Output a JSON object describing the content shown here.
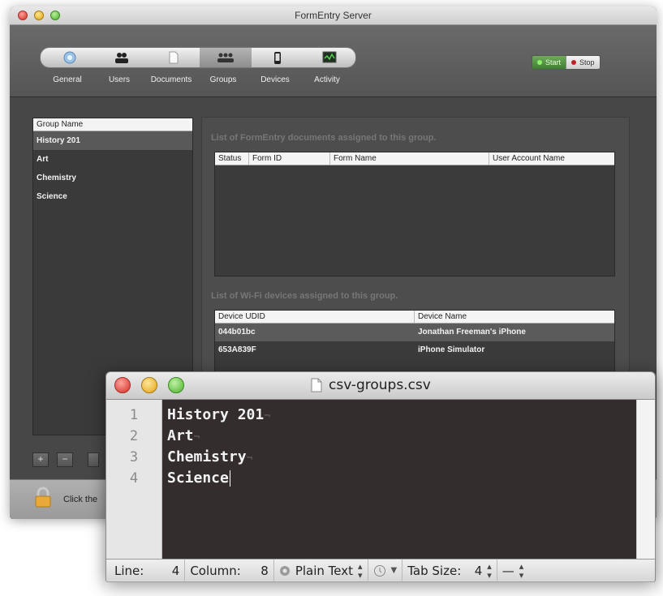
{
  "server_window": {
    "title": "FormEntry Server",
    "toolbar": {
      "tabs": [
        {
          "label": "General",
          "icon": "gear-globe-icon"
        },
        {
          "label": "Users",
          "icon": "users-icon"
        },
        {
          "label": "Documents",
          "icon": "document-icon"
        },
        {
          "label": "Groups",
          "icon": "groups-icon"
        },
        {
          "label": "Devices",
          "icon": "device-icon"
        },
        {
          "label": "Activity",
          "icon": "activity-monitor-icon"
        }
      ],
      "active_tab": "Groups",
      "start_label": "Start",
      "stop_label": "Stop"
    },
    "group_list": {
      "header": "Group Name",
      "items": [
        "History 201",
        "Art",
        "Chemistry",
        "Science"
      ],
      "selected": "History 201",
      "add_label": "+",
      "remove_label": "−"
    },
    "documents_section": {
      "label": "List of FormEntry documents assigned to this group.",
      "columns": [
        "Status",
        "Form ID",
        "Form Name",
        "User Account Name"
      ],
      "rows": []
    },
    "devices_section": {
      "label": "List of Wi-Fi devices assigned to this group.",
      "columns": [
        "Device UDID",
        "Device Name"
      ],
      "rows": [
        {
          "udid": "044b01bc",
          "name": "Jonathan Freeman's iPhone"
        },
        {
          "udid": "653A839F",
          "name": "iPhone Simulator"
        }
      ]
    },
    "status_text": "Click the"
  },
  "editor_window": {
    "filename": "csv-groups.csv",
    "lines": [
      "History 201",
      "Art",
      "Chemistry",
      "Science"
    ],
    "line_numbers": [
      "1",
      "2",
      "3",
      "4"
    ],
    "status": {
      "line_label": "Line:",
      "line_value": "4",
      "column_label": "Column:",
      "column_value": "8",
      "syntax": "Plain Text",
      "tab_size_label": "Tab Size:",
      "tab_size_value": "4",
      "dash": "—"
    }
  }
}
